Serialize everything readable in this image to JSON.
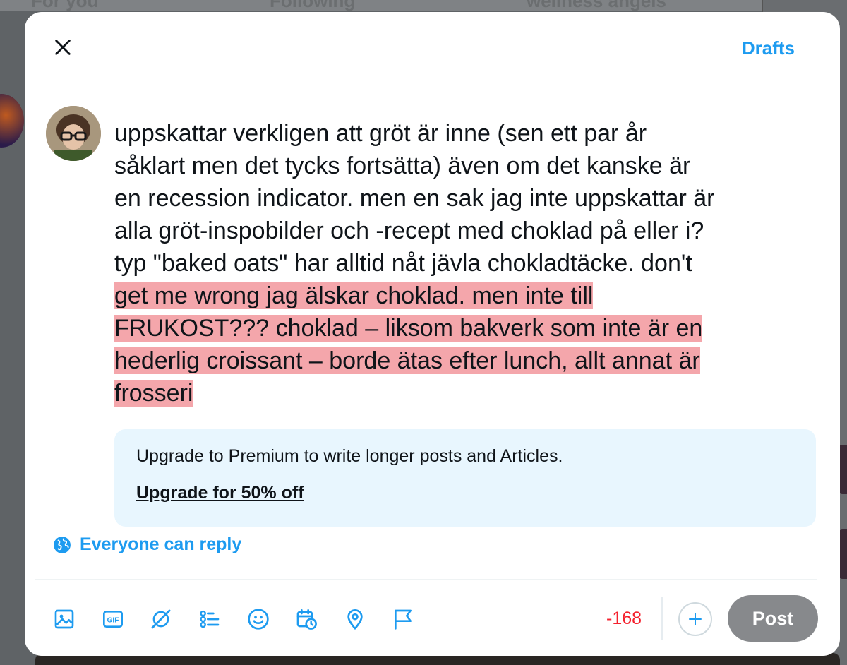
{
  "background": {
    "tabs": [
      "For you",
      "Following",
      "wellness angels"
    ]
  },
  "header": {
    "close_icon": "close-icon",
    "drafts_label": "Drafts"
  },
  "compose": {
    "text_lines": [
      "uppskattar verkligen att gröt är inne (sen ett par år",
      "såklart men det tycks fortsätta) även om det kanske är",
      "en recession indicator. men en sak jag inte uppskattar är",
      "alla gröt-inspobilder och -recept med choklad på eller i?",
      "typ \"baked oats\" har alltid nåt jävla chokladtäcke. don't",
      "get me wrong jag älskar choklad. men inte till",
      "FRUKOST??? choklad – liksom bakverk som inte är en",
      "hederlig croissant – borde ätas efter lunch, allt annat är",
      "frosseri"
    ],
    "overflow_highlight_color": "#f4a6ab"
  },
  "premium": {
    "message": "Upgrade to Premium to write longer posts and Articles.",
    "link_label": "Upgrade for 50% off"
  },
  "reply_setting": {
    "icon": "globe-icon",
    "label": "Everyone can reply"
  },
  "toolbar": {
    "icons": [
      "image-icon",
      "gif-icon",
      "grok-icon",
      "poll-icon",
      "emoji-icon",
      "schedule-icon",
      "location-icon",
      "flag-icon"
    ],
    "gif_label": "GIF",
    "char_count": "-168",
    "add_icon": "plus-icon",
    "post_label": "Post"
  },
  "colors": {
    "accent": "#1d9bf0",
    "over_limit": "#f4212e",
    "post_disabled": "#87898c"
  }
}
